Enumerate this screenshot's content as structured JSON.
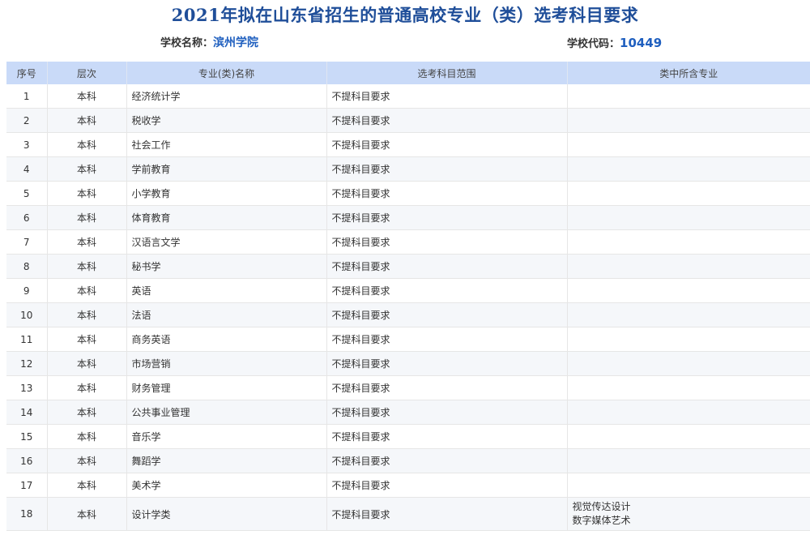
{
  "header": {
    "title": "2021年拟在山东省招生的普通高校专业（类）选考科目要求",
    "school_name_label": "学校名称：",
    "school_name": "滨州学院",
    "school_code_label": "学校代码：",
    "school_code": "10449"
  },
  "table": {
    "columns": [
      "序号",
      "层次",
      "专业(类)名称",
      "选考科目范围",
      "类中所含专业"
    ],
    "rows": [
      {
        "no": "1",
        "level": "本科",
        "major": "经济统计学",
        "subjects": "不提科目要求",
        "included": []
      },
      {
        "no": "2",
        "level": "本科",
        "major": "税收学",
        "subjects": "不提科目要求",
        "included": []
      },
      {
        "no": "3",
        "level": "本科",
        "major": "社会工作",
        "subjects": "不提科目要求",
        "included": []
      },
      {
        "no": "4",
        "level": "本科",
        "major": "学前教育",
        "subjects": "不提科目要求",
        "included": []
      },
      {
        "no": "5",
        "level": "本科",
        "major": "小学教育",
        "subjects": "不提科目要求",
        "included": []
      },
      {
        "no": "6",
        "level": "本科",
        "major": "体育教育",
        "subjects": "不提科目要求",
        "included": []
      },
      {
        "no": "7",
        "level": "本科",
        "major": "汉语言文学",
        "subjects": "不提科目要求",
        "included": []
      },
      {
        "no": "8",
        "level": "本科",
        "major": "秘书学",
        "subjects": "不提科目要求",
        "included": []
      },
      {
        "no": "9",
        "level": "本科",
        "major": "英语",
        "subjects": "不提科目要求",
        "included": []
      },
      {
        "no": "10",
        "level": "本科",
        "major": "法语",
        "subjects": "不提科目要求",
        "included": []
      },
      {
        "no": "11",
        "level": "本科",
        "major": "商务英语",
        "subjects": "不提科目要求",
        "included": []
      },
      {
        "no": "12",
        "level": "本科",
        "major": "市场营销",
        "subjects": "不提科目要求",
        "included": []
      },
      {
        "no": "13",
        "level": "本科",
        "major": "财务管理",
        "subjects": "不提科目要求",
        "included": []
      },
      {
        "no": "14",
        "level": "本科",
        "major": "公共事业管理",
        "subjects": "不提科目要求",
        "included": []
      },
      {
        "no": "15",
        "level": "本科",
        "major": "音乐学",
        "subjects": "不提科目要求",
        "included": []
      },
      {
        "no": "16",
        "level": "本科",
        "major": "舞蹈学",
        "subjects": "不提科目要求",
        "included": []
      },
      {
        "no": "17",
        "level": "本科",
        "major": "美术学",
        "subjects": "不提科目要求",
        "included": []
      },
      {
        "no": "18",
        "level": "本科",
        "major": "设计学类",
        "subjects": "不提科目要求",
        "included": [
          "视觉传达设计",
          "数字媒体艺术"
        ]
      }
    ]
  },
  "colors": {
    "title": "#1f4e99",
    "header_bg": "#c9daf8",
    "value_accent": "#1f5fbf",
    "stripe": "#f5f7fa"
  }
}
